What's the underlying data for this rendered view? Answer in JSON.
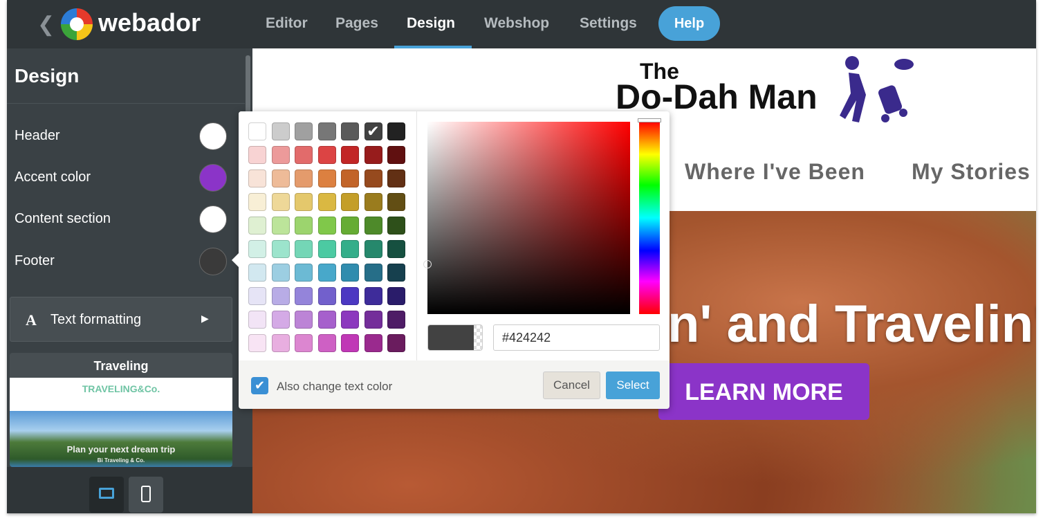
{
  "app": {
    "logo": "webador",
    "back_icon": "chevron-left-icon"
  },
  "nav": {
    "items": [
      {
        "label": "Editor"
      },
      {
        "label": "Pages"
      },
      {
        "label": "Design",
        "active": true
      },
      {
        "label": "Webshop"
      },
      {
        "label": "Settings"
      }
    ],
    "help": "Help"
  },
  "sidebar": {
    "title": "Design",
    "rows": [
      {
        "label": "Header",
        "color": "#ffffff"
      },
      {
        "label": "Accent color",
        "color": "#8b34c8"
      },
      {
        "label": "Content section",
        "color": "#ffffff"
      },
      {
        "label": "Footer",
        "color": "#3a3a3a"
      }
    ],
    "text_formatting": "Text formatting",
    "theme": {
      "label": "Traveling",
      "thumb_brand": "TRAVELING&Co.",
      "thumb_title": "Plan your next dream trip",
      "thumb_sub": "Bi Traveling & Co."
    }
  },
  "devices": {
    "desktop": "desktop-icon",
    "mobile": "mobile-icon"
  },
  "site": {
    "brand_small": "The",
    "brand": "Do-Dah Man",
    "menu": [
      "Where I've Been",
      "My Stories"
    ],
    "hero_title": "n' and Travelin'",
    "cta": "LEARN MORE"
  },
  "color_picker": {
    "palette": [
      [
        "#ffffff",
        "#cccccc",
        "#a0a0a0",
        "#777777",
        "#5a5a5a",
        "#424242",
        "#222222"
      ],
      [
        "#f8d3d3",
        "#ec9a9a",
        "#e26b6b",
        "#dc4444",
        "#c22626",
        "#971c1c",
        "#601010"
      ],
      [
        "#f8e3d8",
        "#eebb98",
        "#e49b6c",
        "#dc8040",
        "#c26428",
        "#964a1e",
        "#623014"
      ],
      [
        "#f8efd6",
        "#eed898",
        "#e4c86c",
        "#dab842",
        "#c49e28",
        "#9a7c1e",
        "#624e14"
      ],
      [
        "#dff0d2",
        "#bce49a",
        "#9cd46e",
        "#80c84a",
        "#66ac34",
        "#4e8a2a",
        "#2e501a"
      ],
      [
        "#d2f0e6",
        "#9ce4cc",
        "#74d6b6",
        "#4ccaa2",
        "#34ae8a",
        "#26886c",
        "#165040"
      ],
      [
        "#d2e8f0",
        "#9ccee2",
        "#6cbad4",
        "#48a8ca",
        "#308cae",
        "#266e88",
        "#16404e"
      ],
      [
        "#e6e4f6",
        "#b8ace6",
        "#9484da",
        "#7260cc",
        "#4c38c2",
        "#3e2c9a",
        "#2a1c6a"
      ],
      [
        "#f2e4f6",
        "#d4aae6",
        "#bc84d6",
        "#a660cc",
        "#8c38be",
        "#742e9a",
        "#4e1c66"
      ],
      [
        "#f8e4f4",
        "#e8aee0",
        "#dc86d0",
        "#ce60c4",
        "#c038b6",
        "#9a2a8e",
        "#6a1c5e"
      ]
    ],
    "selected": "#424242",
    "hex_value": "#424242",
    "also_change_text": "Also change text color",
    "also_change_checked": true,
    "cancel": "Cancel",
    "select": "Select"
  }
}
